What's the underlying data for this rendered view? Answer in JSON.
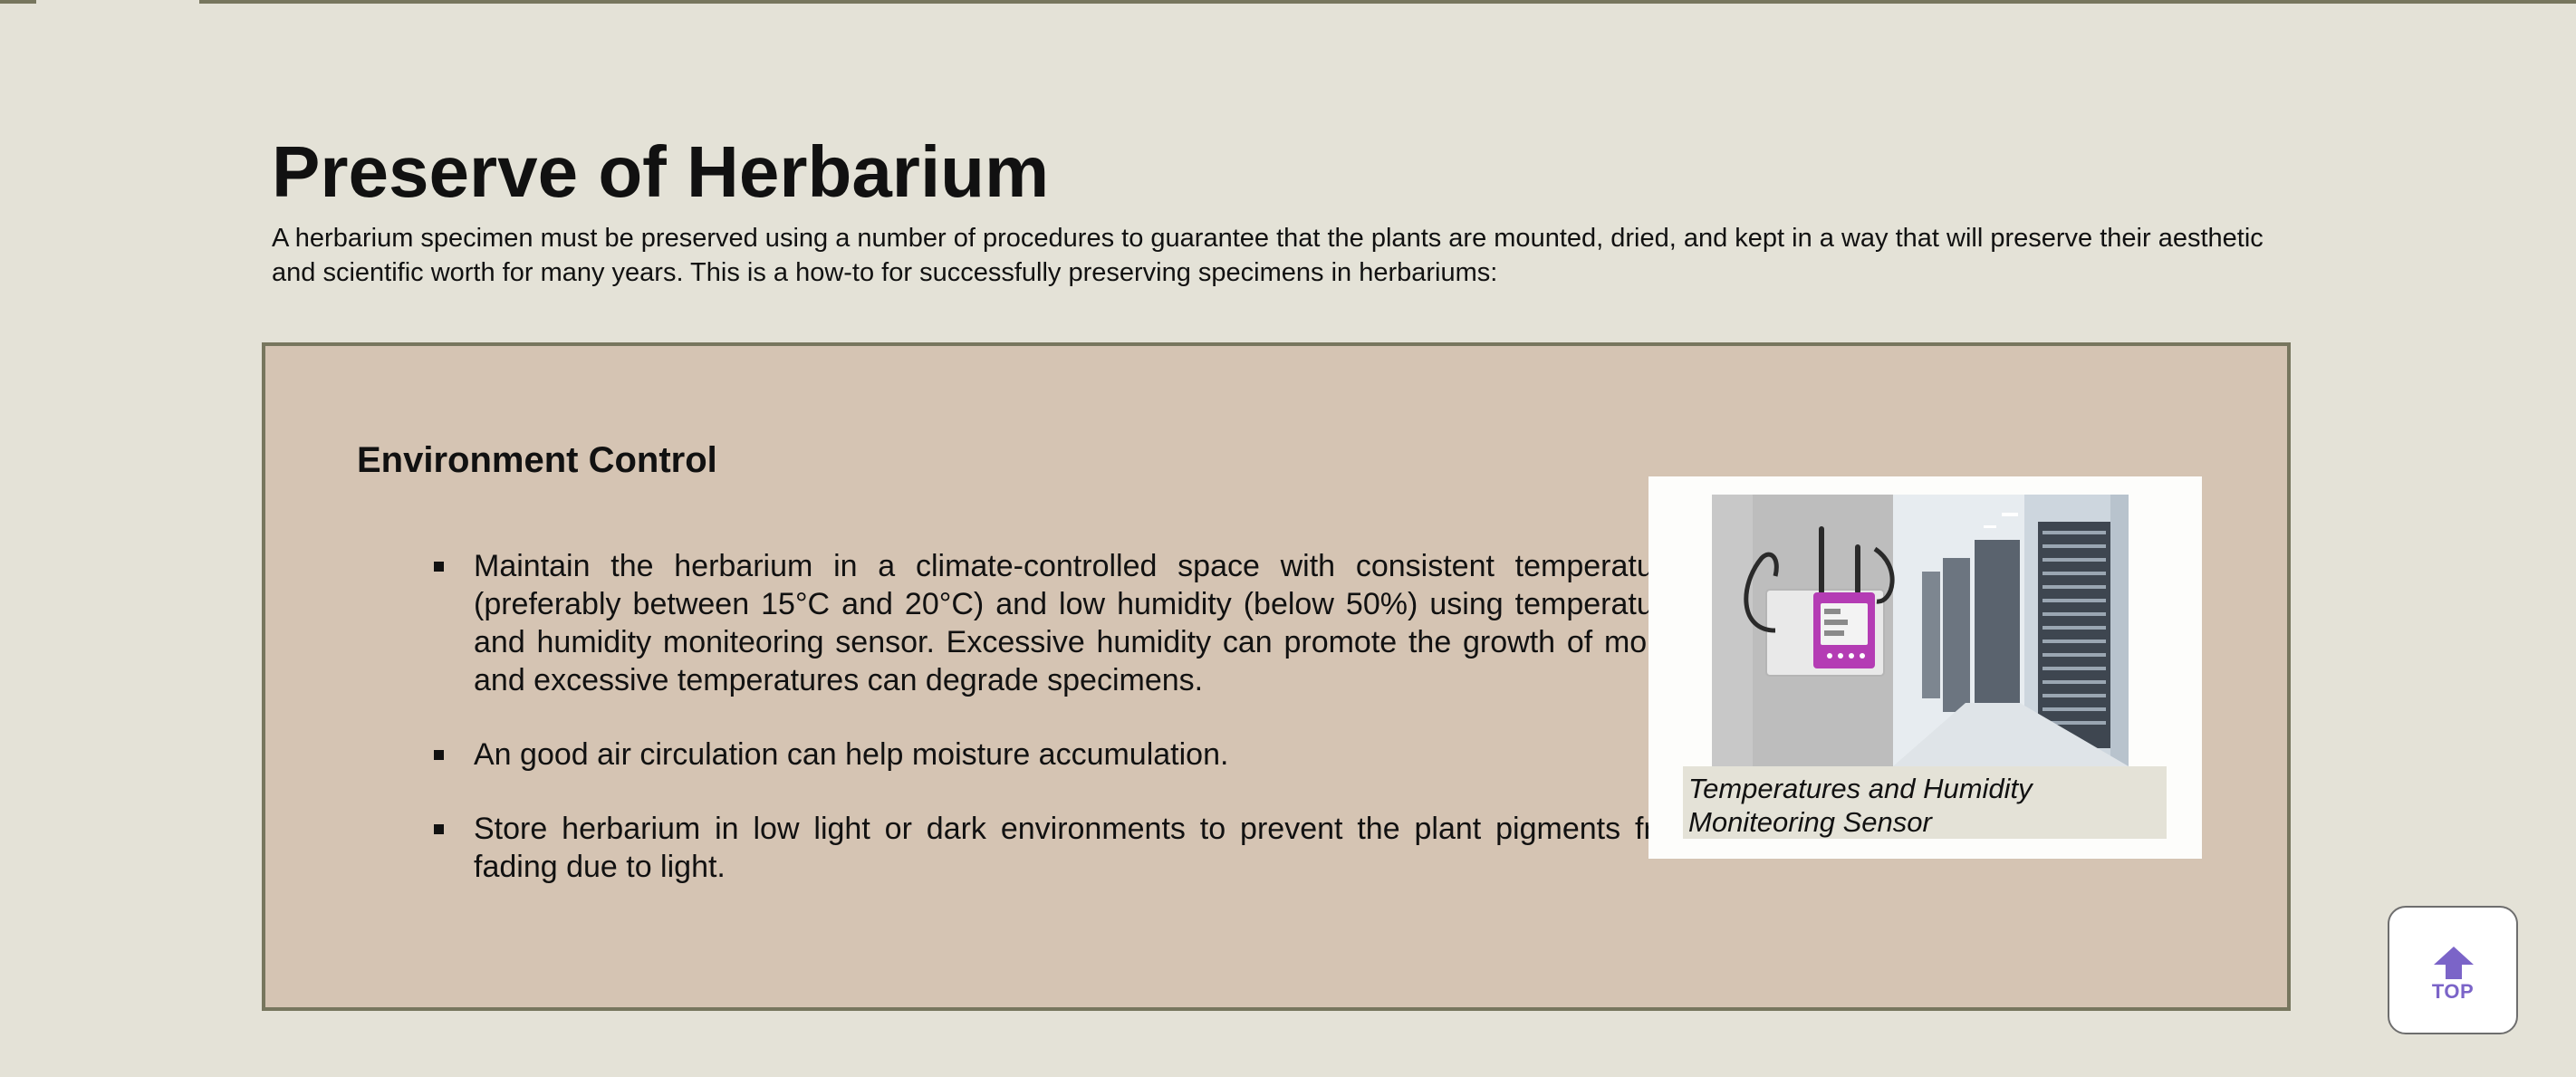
{
  "page": {
    "title": "Preserve of Herbarium",
    "intro": "A herbarium specimen must be preserved using a number of procedures to guarantee that the plants are mounted, dried, and kept in a way that will preserve their aesthetic and scientific worth for many years. This is a how-to for successfully preserving specimens in herbariums:"
  },
  "section": {
    "heading": "Environment Control",
    "bullets": [
      "Maintain the herbarium in a climate-controlled space with consistent temperatures (preferably between 15°C and 20°C) and low humidity (below 50%) using temperatures and humidity moniteoring sensor. Excessive humidity can promote the growth of mould, and excessive temperatures can degrade specimens.",
      "An good air circulation can help moisture accumulation.",
      "Store herbarium in low light or dark environments to prevent the plant pigments from fading due to light."
    ],
    "figure_caption": "Temperatures and Humidity Moniteoring Sensor"
  },
  "top_button": {
    "label": "TOP",
    "icon": "arrow-up-icon"
  },
  "colors": {
    "background": "#e4e2d7",
    "panel": "#d5c4b3",
    "border": "#77765e",
    "accent": "#7b64c8"
  }
}
